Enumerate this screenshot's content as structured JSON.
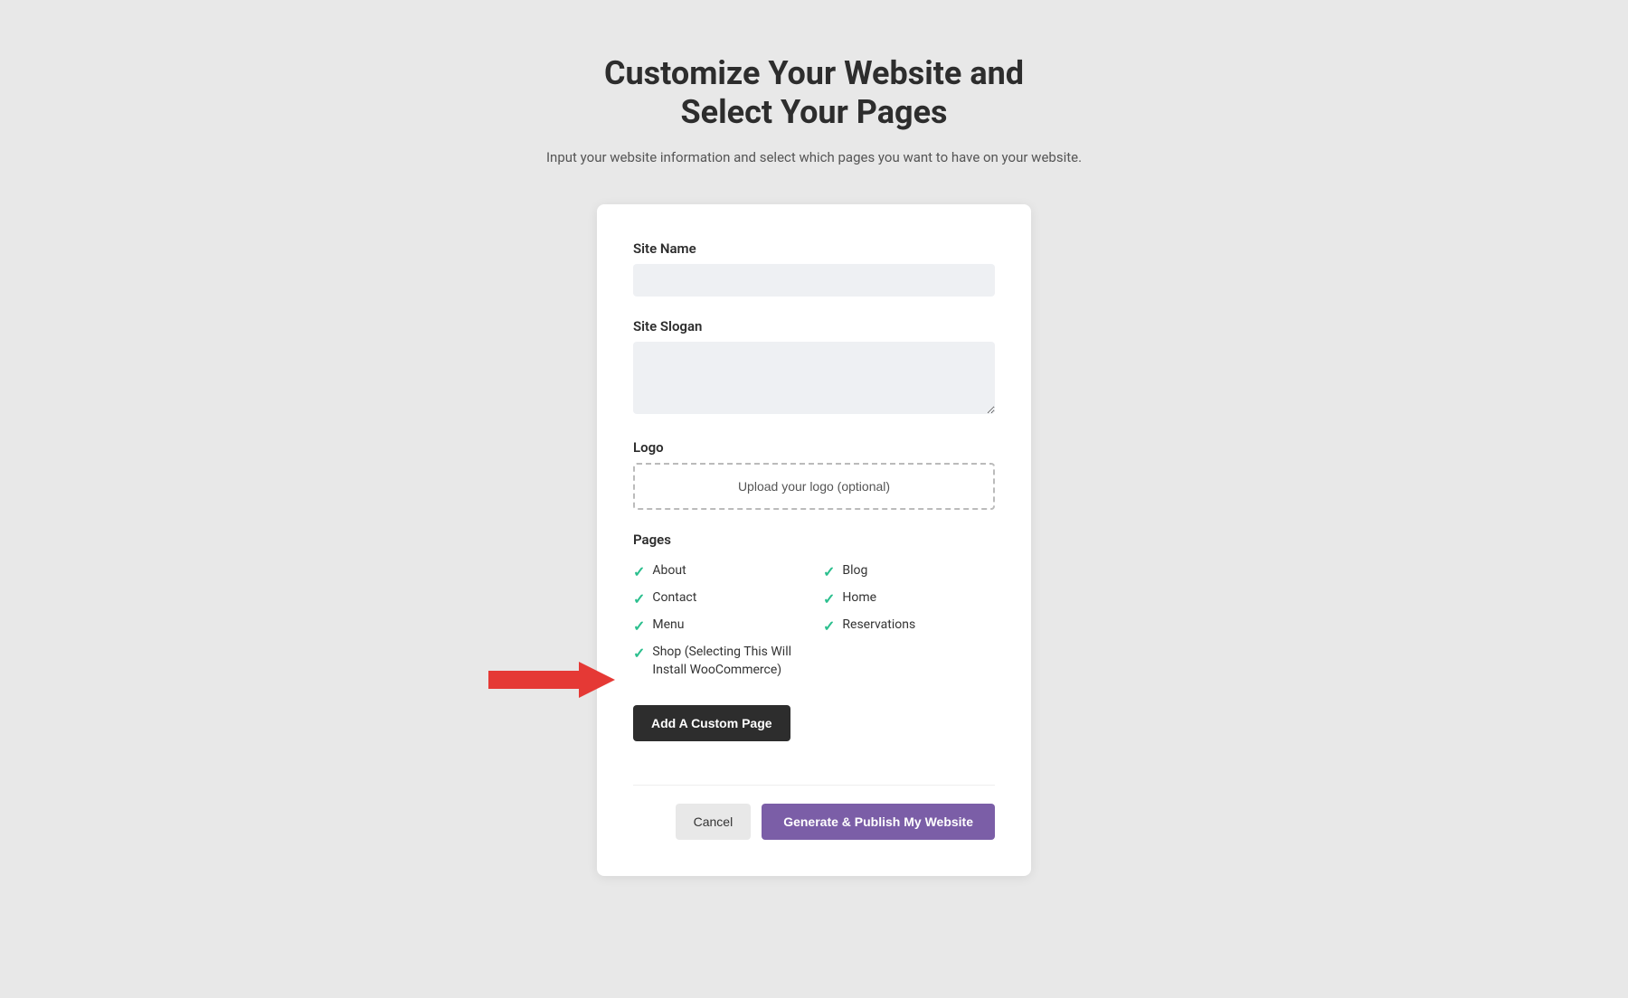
{
  "header": {
    "title_line1": "Customize Your Website and",
    "title_line2": "Select Your Pages",
    "subtitle": "Input your website information and select which pages you want to have on your website."
  },
  "form": {
    "site_name_label": "Site Name",
    "site_name_placeholder": "",
    "site_slogan_label": "Site Slogan",
    "site_slogan_placeholder": "",
    "logo_label": "Logo",
    "logo_upload_text": "Upload your logo (optional)",
    "pages_label": "Pages",
    "pages": [
      {
        "label": "About",
        "checked": true,
        "col": 1
      },
      {
        "label": "Blog",
        "checked": true,
        "col": 2
      },
      {
        "label": "Contact",
        "checked": true,
        "col": 1
      },
      {
        "label": "Home",
        "checked": true,
        "col": 2
      },
      {
        "label": "Menu",
        "checked": true,
        "col": 1
      },
      {
        "label": "Reservations",
        "checked": true,
        "col": 2
      },
      {
        "label": "Shop (Selecting This Will Install WooCommerce)",
        "checked": true,
        "col": 1,
        "wide": true
      }
    ],
    "add_custom_page_label": "Add A Custom Page",
    "cancel_label": "Cancel",
    "generate_label": "Generate & Publish My Website"
  },
  "colors": {
    "accent": "#7b5ea7",
    "checkmark": "#2bbf8e",
    "arrow": "#e53935",
    "dark_btn": "#2d2d2d"
  }
}
